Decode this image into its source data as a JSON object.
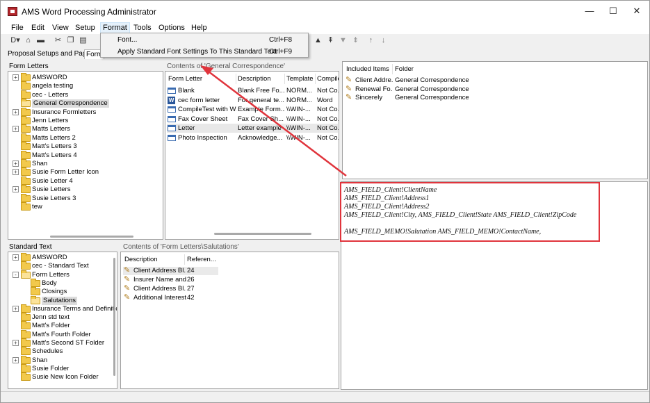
{
  "window": {
    "title": "AMS Word Processing Administrator",
    "controls": {
      "minimize": "—",
      "maximize": "☐",
      "close": "✕"
    }
  },
  "menu": [
    "File",
    "Edit",
    "View",
    "Setup",
    "Format",
    "Tools",
    "Options",
    "Help"
  ],
  "format_menu": {
    "items": [
      {
        "label": "Font...",
        "shortcut": "Ctrl+F8"
      },
      {
        "label": "Apply Standard Font Settings To This Standard Text",
        "shortcut": "Ctrl+F9"
      }
    ]
  },
  "tabs": [
    "Proposal Setups and Pages",
    "Form"
  ],
  "form_letters": {
    "label": "Form Letters",
    "tree": [
      {
        "label": "AMSWORD",
        "expander": "+"
      },
      {
        "label": "angela testing",
        "expander": ""
      },
      {
        "label": "cec - Letters",
        "expander": ""
      },
      {
        "label": "General Correspondence",
        "expander": "",
        "open": true,
        "selected": true
      },
      {
        "label": "Insurance Formletters",
        "expander": "+"
      },
      {
        "label": "Jenn Letters",
        "expander": ""
      },
      {
        "label": "Matts Letters",
        "expander": "+"
      },
      {
        "label": "Matts Letters 2",
        "expander": ""
      },
      {
        "label": "Matt's Letters 3",
        "expander": ""
      },
      {
        "label": "Matt's Letters 4",
        "expander": ""
      },
      {
        "label": "Shan",
        "expander": "+"
      },
      {
        "label": "Susie Form Letter Icon",
        "expander": "+"
      },
      {
        "label": "Susie Letter 4",
        "expander": ""
      },
      {
        "label": "Susie Letters",
        "expander": "+"
      },
      {
        "label": "Susie Letters 3",
        "expander": ""
      },
      {
        "label": "tew",
        "expander": ""
      }
    ]
  },
  "contents_general": {
    "label": "Contents of 'General Correspondence'",
    "columns": [
      "Form Letter",
      "Description",
      "Template",
      "Compiled"
    ],
    "rows": [
      {
        "icon": "doc",
        "cells": [
          "Blank",
          "Blank Free Fo...",
          "NORM...",
          "Not Co..."
        ]
      },
      {
        "icon": "word",
        "cells": [
          "cec form letter",
          "For general te...",
          "NORM...",
          "Word"
        ]
      },
      {
        "icon": "doc",
        "cells": [
          "CompileTest with W...",
          "Example Form...",
          "\\\\WIN-...",
          "Not Co..."
        ]
      },
      {
        "icon": "doc",
        "cells": [
          "Fax Cover Sheet",
          "Fax Cover Sh...",
          "\\\\WIN-...",
          "Not Co..."
        ]
      },
      {
        "icon": "doc",
        "cells": [
          "Letter",
          "Letter example",
          "\\\\WIN-...",
          "Not Co..."
        ],
        "selected": true
      },
      {
        "icon": "doc",
        "cells": [
          "Photo Inspection",
          "Acknowledge...",
          "\\\\WIN-...",
          "Not Co..."
        ]
      }
    ]
  },
  "included_items": {
    "columns": [
      "Included Items",
      "Folder"
    ],
    "rows": [
      [
        "Client Addre...",
        "General Correspondence"
      ],
      [
        "Renewal Fo...",
        "General Correspondence"
      ],
      [
        "Sincerely",
        "General Correspondence"
      ]
    ]
  },
  "preview": {
    "lines": [
      "AMS_FIELD_Client!ClientName",
      "AMS_FIELD_Client!Address1",
      "AMS_FIELD_Client!Address2",
      "AMS_FIELD_Client!City, AMS_FIELD_Client!State  AMS_FIELD_Client!ZipCode",
      "",
      "AMS_FIELD_MEMO!Salutation AMS_FIELD_MEMO!ContactName,"
    ],
    "highlight_color": "#e0343c"
  },
  "standard_text": {
    "label": "Standard Text",
    "tree": [
      {
        "label": "AMSWORD",
        "expander": "+",
        "indent": 0
      },
      {
        "label": "cec - Standard Text",
        "expander": "",
        "indent": 0
      },
      {
        "label": "Form Letters",
        "expander": "-",
        "indent": 0,
        "open": true
      },
      {
        "label": "Body",
        "expander": "",
        "indent": 1
      },
      {
        "label": "Closings",
        "expander": "",
        "indent": 1
      },
      {
        "label": "Salutations",
        "expander": "",
        "indent": 1,
        "open": true,
        "selected": true
      },
      {
        "label": "Insurance Terms and Definitio",
        "expander": "+",
        "indent": 0
      },
      {
        "label": "Jenn std text",
        "expander": "",
        "indent": 0
      },
      {
        "label": "Matt's Folder",
        "expander": "",
        "indent": 0
      },
      {
        "label": "Matt's Fourth Folder",
        "expander": "",
        "indent": 0
      },
      {
        "label": "Matt's Second ST Folder",
        "expander": "+",
        "indent": 0
      },
      {
        "label": "Schedules",
        "expander": "",
        "indent": 0
      },
      {
        "label": "Shan",
        "expander": "+",
        "indent": 0
      },
      {
        "label": "Susie Folder",
        "expander": "",
        "indent": 0
      },
      {
        "label": "Susie New Icon Folder",
        "expander": "",
        "indent": 0
      }
    ]
  },
  "contents_salutations": {
    "label": "Contents of 'Form Letters\\Salutations'",
    "columns": [
      "Description",
      "Referen..."
    ],
    "rows": [
      [
        "Client Address Bl...",
        "24"
      ],
      [
        "Insurer Name and...",
        "26"
      ],
      [
        "Client Address Bl...",
        "27"
      ],
      [
        "Additional Interest...",
        "42"
      ]
    ]
  },
  "toolbar_icons": [
    "new-icon",
    "open-icon",
    "save-icon",
    "cut-icon",
    "copy-icon",
    "paste-icon"
  ],
  "toolbar_glyphs": [
    "D▾",
    "⌂",
    "▬",
    "✂",
    "❐",
    "▤",
    "▲",
    "⇞",
    "▼",
    "⇟",
    "↑",
    "↓"
  ]
}
